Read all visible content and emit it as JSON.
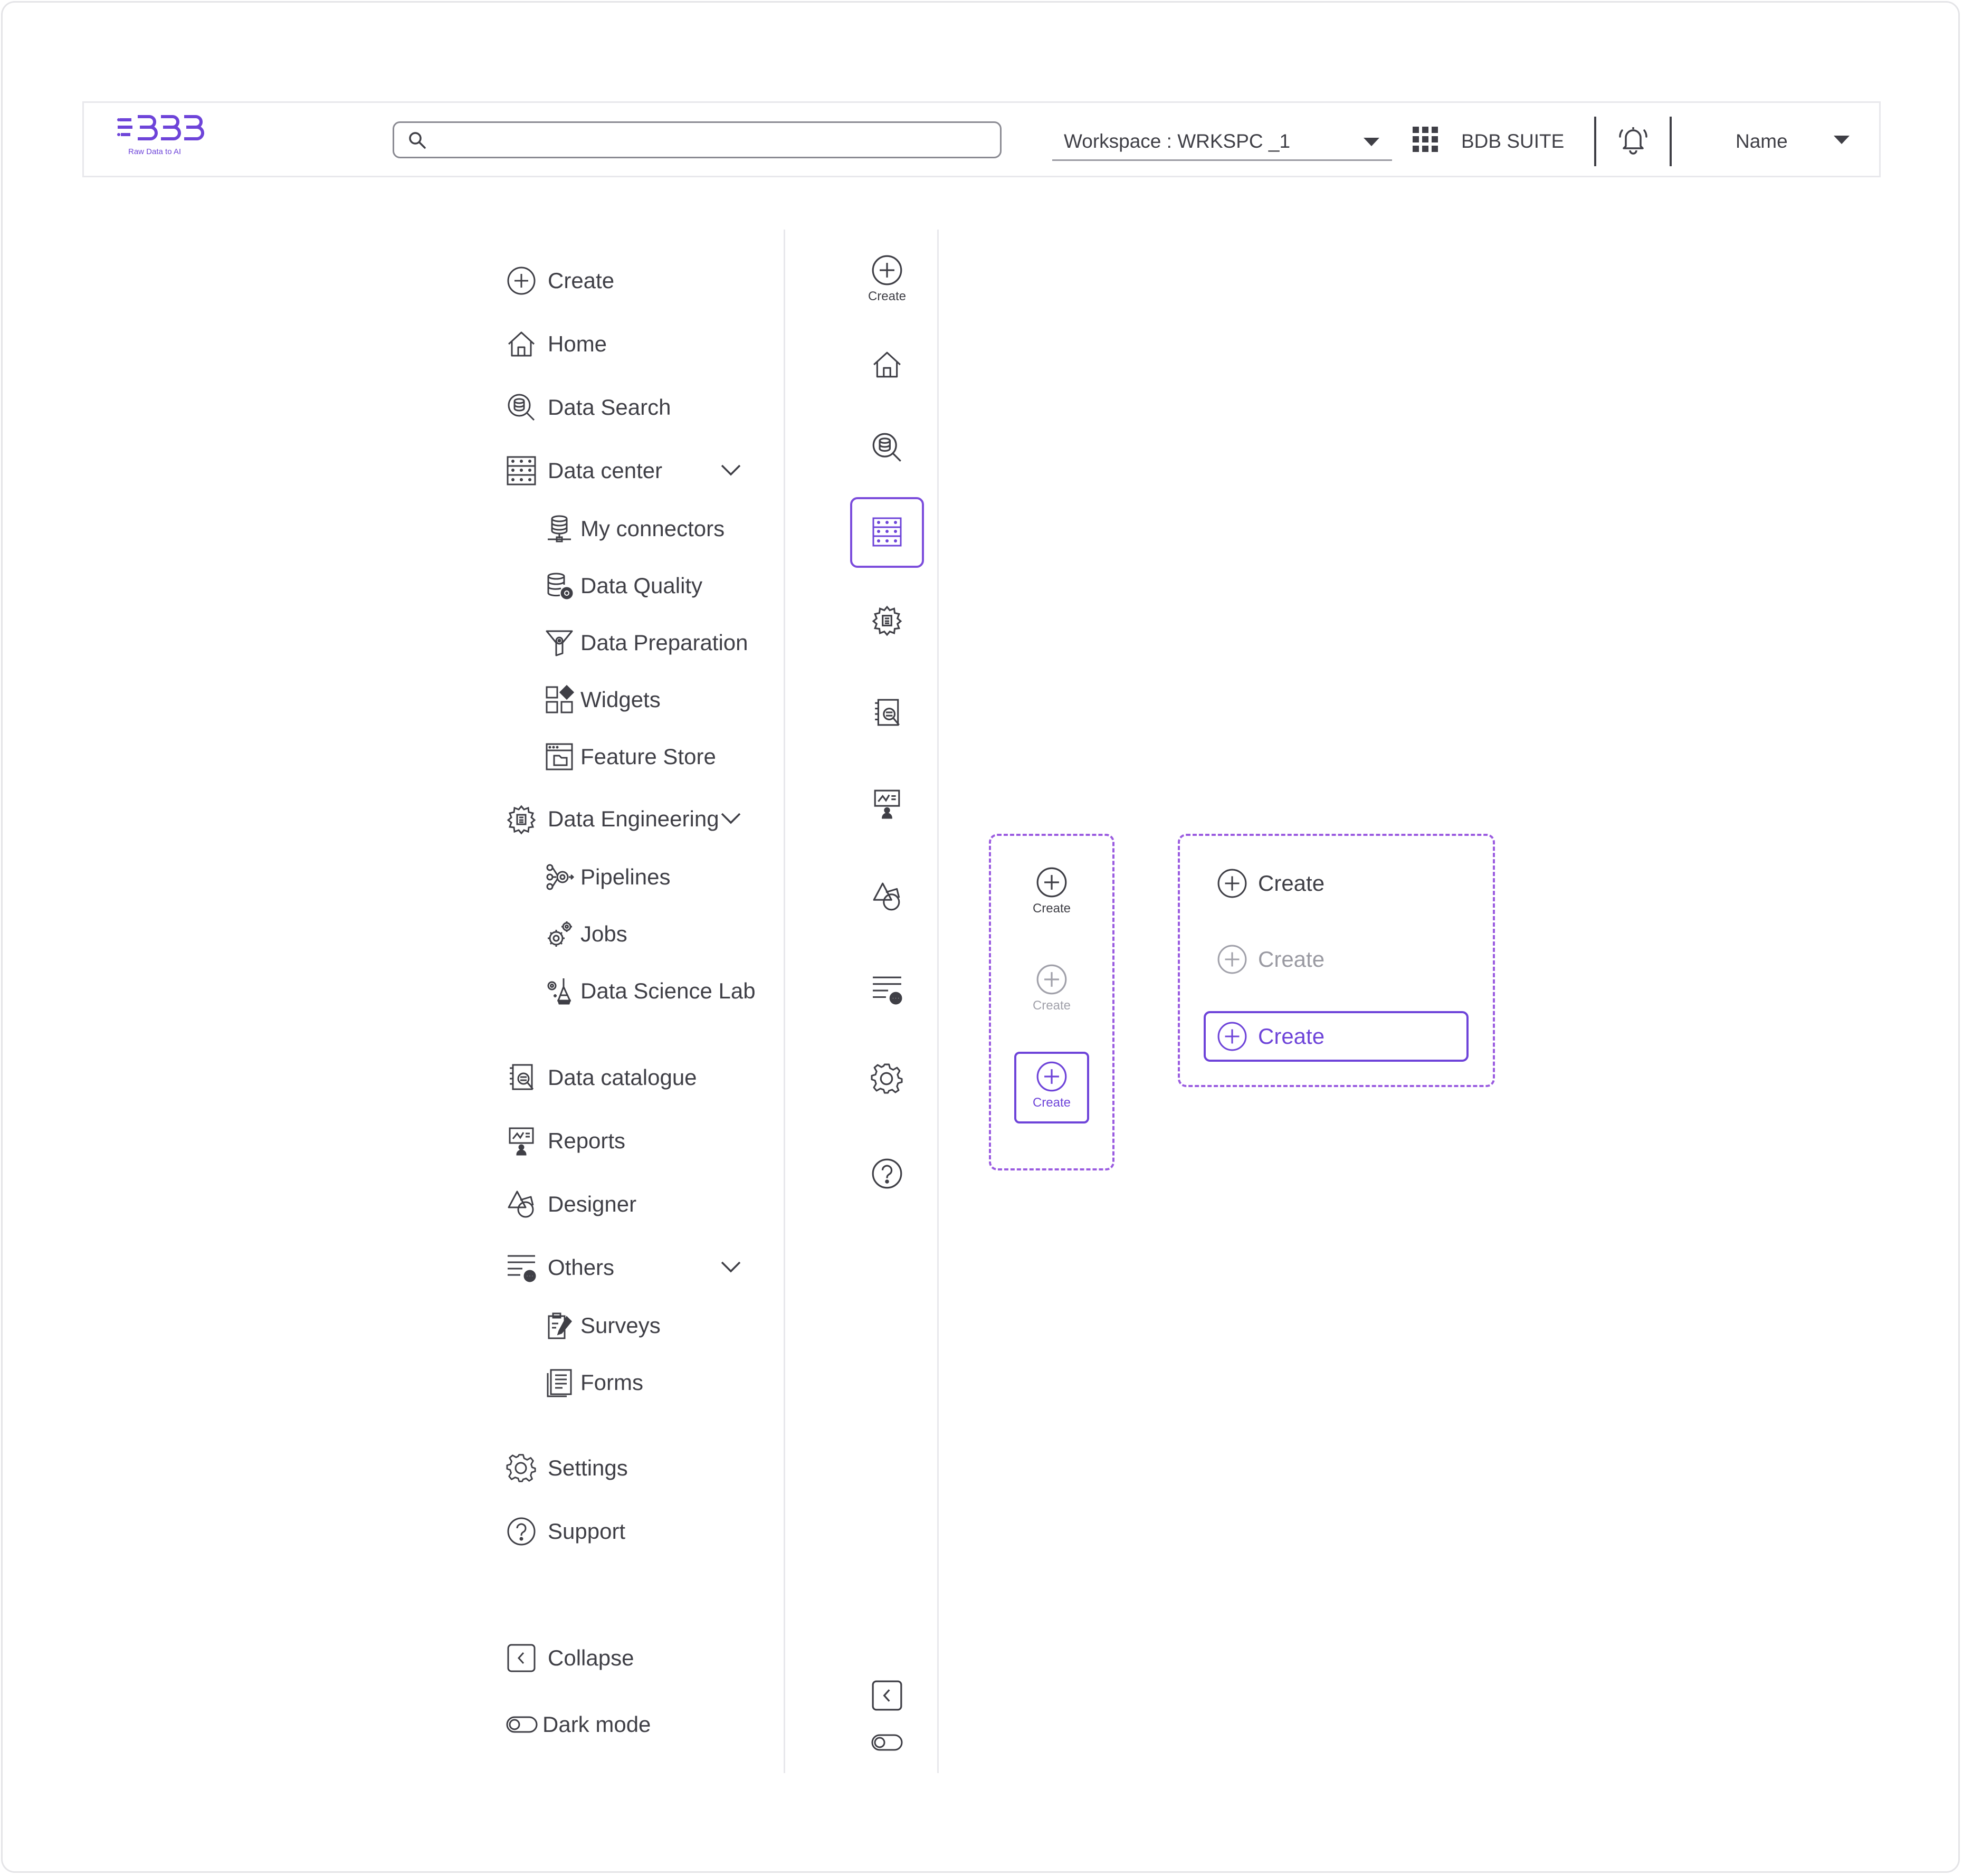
{
  "brand": {
    "logo_text": "BDB",
    "tagline": "Raw Data to AI",
    "color": "#6e44d9"
  },
  "search": {
    "value": "",
    "placeholder": ""
  },
  "workspace": {
    "label": "Workspace : WRKSPC _1"
  },
  "suite": {
    "label": "BDB SUITE"
  },
  "user": {
    "name": "Name"
  },
  "colors": {
    "accent": "#6e44d9",
    "text": "#3f3f46",
    "disabled": "#9a9aa2",
    "dash": "#9a5be0"
  },
  "sidebar": {
    "create": "Create",
    "home": "Home",
    "data_search": "Data Search",
    "data_center": "Data center",
    "data_center_items": [
      "My connectors",
      "Data Quality",
      "Data Preparation",
      "Widgets",
      "Feature Store"
    ],
    "data_engineering": "Data Engineering",
    "data_engineering_items": [
      "Pipelines",
      "Jobs",
      "Data Science Lab"
    ],
    "data_catalogue": "Data catalogue",
    "reports": "Reports",
    "designer": "Designer",
    "others": "Others",
    "others_items": [
      "Surveys",
      "Forms"
    ],
    "settings": "Settings",
    "support": "Support",
    "collapse": "Collapse",
    "dark_mode": "Dark mode"
  },
  "rail": {
    "create_caption": "Create"
  },
  "variants": {
    "vertical": [
      "Create",
      "Create",
      "Create"
    ],
    "horizontal": [
      "Create",
      "Create",
      "Create"
    ]
  }
}
